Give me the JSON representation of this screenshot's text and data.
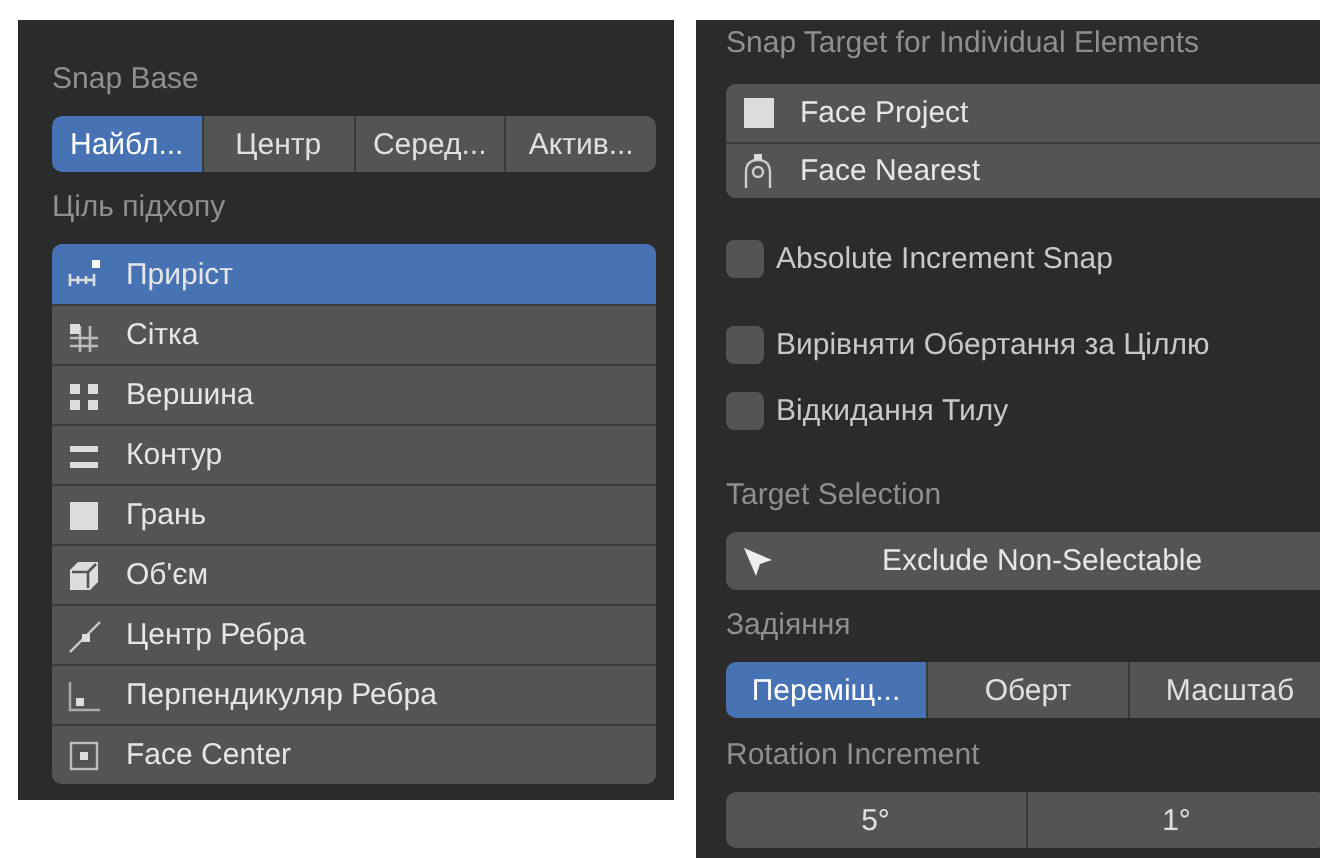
{
  "snap_base": {
    "label": "Snap Base",
    "options": [
      {
        "label": "Найбл...",
        "selected": true
      },
      {
        "label": "Центр",
        "selected": false
      },
      {
        "label": "Серед...",
        "selected": false
      },
      {
        "label": "Актив...",
        "selected": false
      }
    ]
  },
  "snap_target": {
    "label": "Ціль підхопу",
    "items": [
      {
        "label": "Приріст",
        "selected": true
      },
      {
        "label": "Сітка",
        "selected": false
      },
      {
        "label": "Вершина",
        "selected": false
      },
      {
        "label": "Контур",
        "selected": false
      },
      {
        "label": "Грань",
        "selected": false
      },
      {
        "label": "Об'єм",
        "selected": false
      },
      {
        "label": "Центр Ребра",
        "selected": false
      },
      {
        "label": "Перпендикуляр Ребра",
        "selected": false
      },
      {
        "label": "Face Center",
        "selected": false
      }
    ]
  },
  "individual_target": {
    "label": "Snap Target for Individual Elements",
    "items": [
      {
        "label": "Face Project",
        "selected": false
      },
      {
        "label": "Face Nearest",
        "selected": false
      }
    ]
  },
  "options": [
    {
      "label": "Absolute Increment Snap",
      "checked": false
    },
    {
      "label": "Вирівняти Обертання за Ціллю",
      "checked": false
    },
    {
      "label": "Відкидання Тилу",
      "checked": false
    }
  ],
  "target_selection": {
    "label": "Target Selection",
    "value": "Exclude Non-Selectable"
  },
  "affect": {
    "label": "Задіяння",
    "options": [
      {
        "label": "Переміщ...",
        "selected": true
      },
      {
        "label": "Оберт",
        "selected": false
      },
      {
        "label": "Масштаб",
        "selected": false
      }
    ]
  },
  "rotation_increment": {
    "label": "Rotation Increment",
    "values": [
      "5°",
      "1°"
    ]
  }
}
